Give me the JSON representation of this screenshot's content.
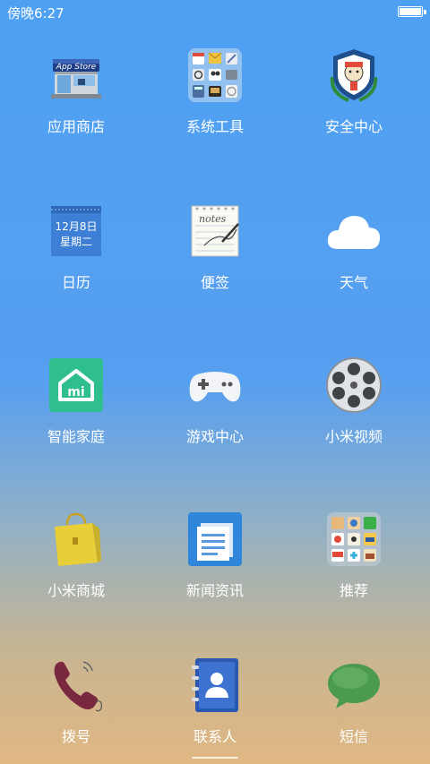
{
  "status_bar": {
    "time": "傍晚6:27"
  },
  "apps": [
    {
      "label": "应用商店",
      "icon": "app-store-icon",
      "text": "App Store"
    },
    {
      "label": "系统工具",
      "icon": "system-tools-folder-icon"
    },
    {
      "label": "安全中心",
      "icon": "security-center-icon"
    },
    {
      "label": "日历",
      "icon": "calendar-icon",
      "date": "12月8日",
      "weekday": "星期二"
    },
    {
      "label": "便签",
      "icon": "notes-icon",
      "text": "notes"
    },
    {
      "label": "天气",
      "icon": "weather-cloud-icon"
    },
    {
      "label": "智能家庭",
      "icon": "smart-home-icon",
      "text": "mi"
    },
    {
      "label": "游戏中心",
      "icon": "game-controller-icon"
    },
    {
      "label": "小米视频",
      "icon": "video-reel-icon"
    },
    {
      "label": "小米商城",
      "icon": "shopping-bag-icon"
    },
    {
      "label": "新闻资讯",
      "icon": "news-icon"
    },
    {
      "label": "推荐",
      "icon": "recommend-folder-icon"
    },
    {
      "label": "拨号",
      "icon": "phone-icon"
    },
    {
      "label": "联系人",
      "icon": "contacts-icon"
    },
    {
      "label": "短信",
      "icon": "message-bubble-icon"
    }
  ],
  "colors": {
    "background_top": "#4ea0f2",
    "background_bottom": "#e0b783"
  }
}
